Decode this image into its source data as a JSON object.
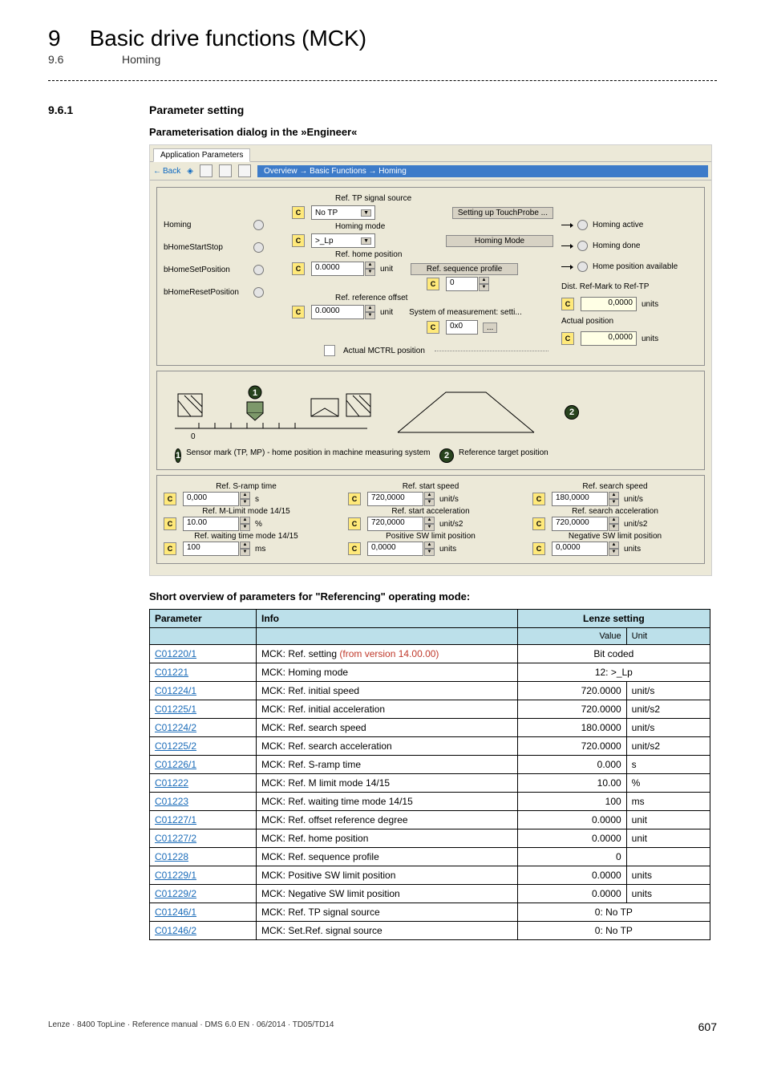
{
  "header": {
    "chap_num": "9",
    "chap_title": "Basic drive functions (MCK)",
    "sub_num": "9.6",
    "sub_title": "Homing"
  },
  "section": {
    "num": "9.6.1",
    "title": "Parameter setting",
    "dialog_title": "Parameterisation dialog in the »Engineer«"
  },
  "shot": {
    "tab": "Application Parameters",
    "nav_back": "Back",
    "breadcrumb": "Overview → Basic Functions → Homing",
    "inputs": {
      "homing": "Homing",
      "startstop": "bHomeStartStop",
      "setpos": "bHomeSetPosition",
      "resetpos": "bHomeResetPosition"
    },
    "center": {
      "tp_src_label": "Ref. TP signal source",
      "tp_src_value": "No TP",
      "setup_tp": "Setting up TouchProbe ...",
      "mode_label": "Homing mode",
      "mode_value": ">_Lp",
      "homing_mode_btn": "Homing Mode",
      "home_pos_label": "Ref. home position",
      "home_pos_value": "0.0000",
      "unit_label": "unit",
      "seq_profile_btn": "Ref. sequence profile",
      "seq_profile_value": "0",
      "ref_offset_label": "Ref. reference offset",
      "ref_offset_value": "0.0000",
      "sys_meas_label": "System of measurement: setti...",
      "sys_meas_value": "0x0",
      "actual_mctrl": "Actual MCTRL position",
      "ellipsis": "..."
    },
    "right": {
      "homing_active": "Homing active",
      "homing_done": "Homing done",
      "home_avail": "Home position available",
      "dist_label": "Dist. Ref-Mark to Ref-TP",
      "dist_value": "0,0000",
      "actual_pos_label": "Actual position",
      "actual_pos_value": "0,0000",
      "units_label": "units"
    },
    "diag": {
      "desc1": "Sensor mark (TP, MP) - home position in machine measuring system",
      "desc2": "Reference target position",
      "num1": "1",
      "num2": "2"
    },
    "bottom": {
      "sramp_label": "Ref. S-ramp time",
      "sramp_value": "0,000",
      "sramp_unit": "s",
      "start_speed_label": "Ref. start speed",
      "start_speed_value": "720,0000",
      "start_speed_unit": "unit/s",
      "search_speed_label": "Ref. search speed",
      "search_speed_value": "180,0000",
      "search_speed_unit": "unit/s",
      "mlimit_label": "Ref. M-Limit mode 14/15",
      "mlimit_value": "10.00",
      "mlimit_unit": "%",
      "start_acc_label": "Ref. start acceleration",
      "start_acc_value": "720,0000",
      "start_acc_unit": "unit/s2",
      "search_acc_label": "Ref. search acceleration",
      "search_acc_value": "720,0000",
      "search_acc_unit": "unit/s2",
      "wait_label": "Ref. waiting time mode 14/15",
      "wait_value": "100",
      "wait_unit": "ms",
      "pos_sw_label": "Positive SW limit position",
      "pos_sw_value": "0,0000",
      "pos_sw_unit": "units",
      "neg_sw_label": "Negative SW limit position",
      "neg_sw_value": "0,0000",
      "neg_sw_unit": "units"
    }
  },
  "params_heading": "Short overview of parameters for \"Referencing\" operating mode:",
  "table": {
    "head_param": "Parameter",
    "head_info": "Info",
    "head_lenze": "Lenze setting",
    "head_value": "Value",
    "head_unit": "Unit",
    "rows": [
      {
        "p": "C01220/1",
        "info": "MCK: Ref. setting ",
        "info_red": "(from version 14.00.00)",
        "center": "Bit coded"
      },
      {
        "p": "C01221",
        "info": "MCK: Homing mode",
        "center": "12: >_Lp"
      },
      {
        "p": "C01224/1",
        "info": "MCK: Ref. initial speed",
        "v": "720.0000",
        "u": "unit/s"
      },
      {
        "p": "C01225/1",
        "info": "MCK: Ref. initial acceleration",
        "v": "720.0000",
        "u": "unit/s2"
      },
      {
        "p": "C01224/2",
        "info": "MCK: Ref. search speed",
        "v": "180.0000",
        "u": "unit/s"
      },
      {
        "p": "C01225/2",
        "info": "MCK: Ref. search acceleration",
        "v": "720.0000",
        "u": "unit/s2"
      },
      {
        "p": "C01226/1",
        "info": "MCK: Ref. S-ramp time",
        "v": "0.000",
        "u": "s"
      },
      {
        "p": "C01222",
        "info": "MCK: Ref. M limit mode 14/15",
        "v": "10.00",
        "u": "%"
      },
      {
        "p": "C01223",
        "info": "MCK: Ref. waiting time mode 14/15",
        "v": "100",
        "u": "ms"
      },
      {
        "p": "C01227/1",
        "info": "MCK: Ref. offset reference degree",
        "v": "0.0000",
        "u": "unit"
      },
      {
        "p": "C01227/2",
        "info": "MCK: Ref. home position",
        "v": "0.0000",
        "u": "unit"
      },
      {
        "p": "C01228",
        "info": "MCK: Ref. sequence profile",
        "v": "0",
        "u": ""
      },
      {
        "p": "C01229/1",
        "info": "MCK: Positive SW limit position",
        "v": "0.0000",
        "u": "units"
      },
      {
        "p": "C01229/2",
        "info": "MCK: Negative SW limit position",
        "v": "0.0000",
        "u": "units"
      },
      {
        "p": "C01246/1",
        "info": "MCK: Ref. TP signal source",
        "center": "0: No TP"
      },
      {
        "p": "C01246/2",
        "info": "MCK: Set.Ref. signal source",
        "center": "0: No TP"
      }
    ]
  },
  "footer": {
    "left": "Lenze · 8400 TopLine · Reference manual · DMS 6.0 EN · 06/2014 · TD05/TD14",
    "page": "607"
  }
}
